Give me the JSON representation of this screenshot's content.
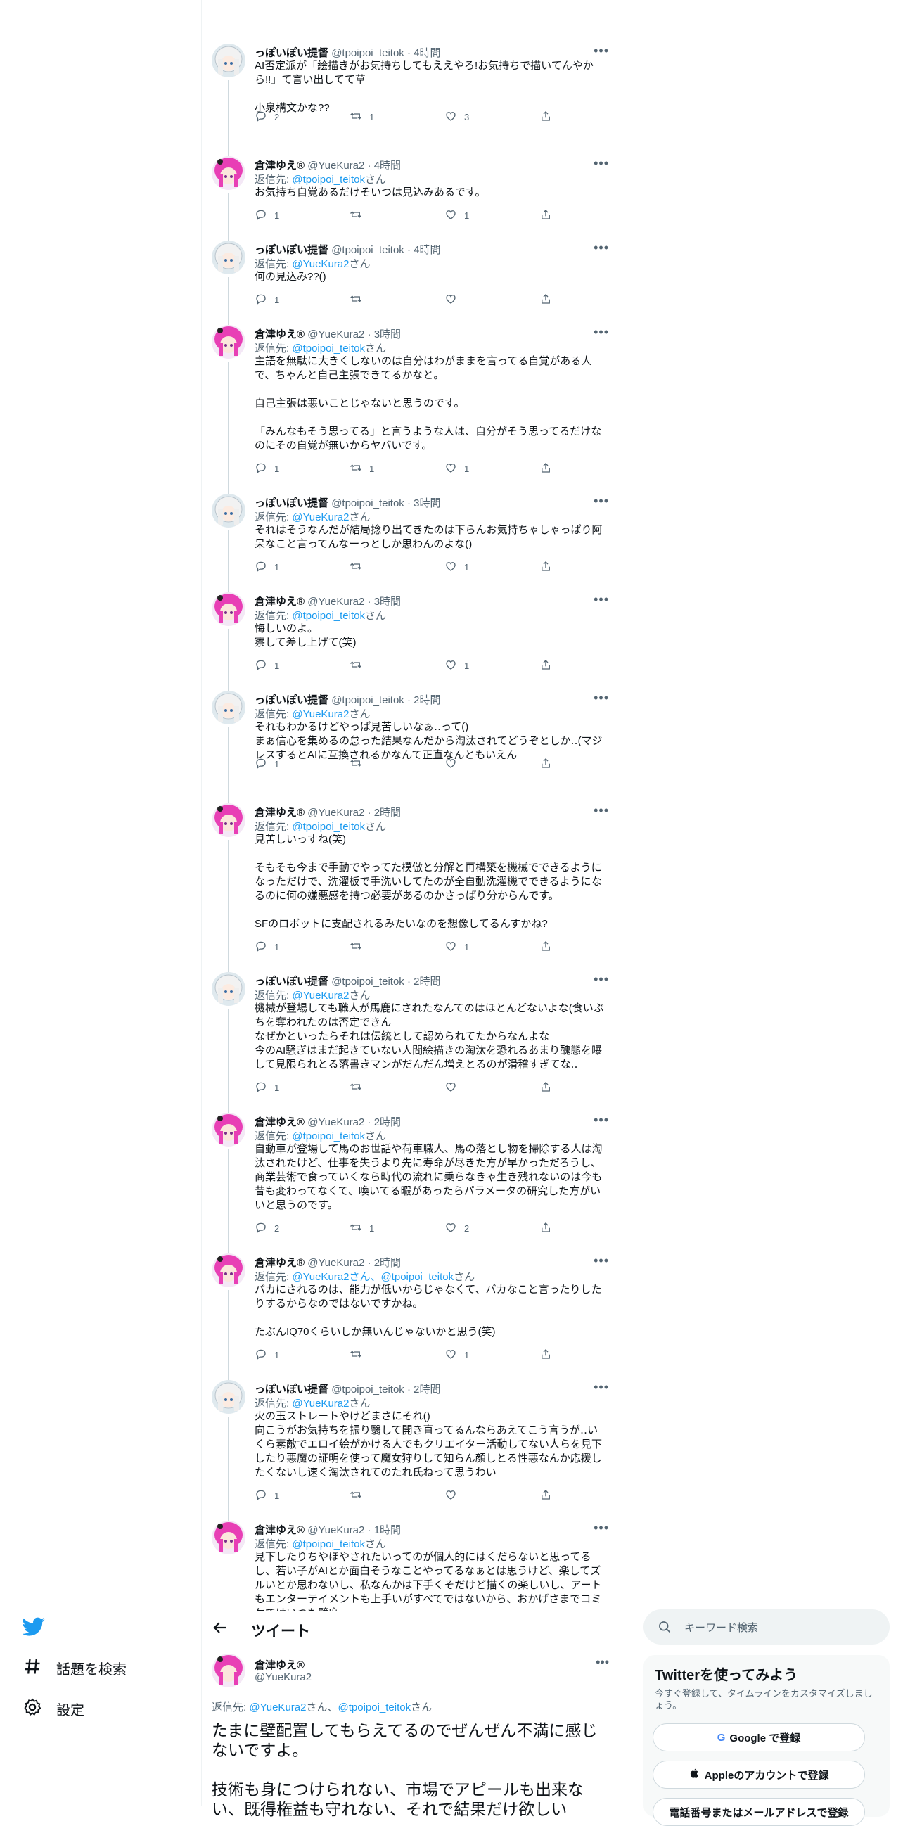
{
  "nav": {
    "explore_label": "話題を検索",
    "settings_label": "設定"
  },
  "header": {
    "title": "ツイート"
  },
  "search": {
    "placeholder": "キーワード検索"
  },
  "promo": {
    "title": "Twitterを使ってみよう",
    "subtitle": "今すぐ登録して、タイムラインをカスタマイズしましょう。",
    "google_label": "Google で登録",
    "apple_label": "Appleのアカウントで登録",
    "phone_label": "電話番号またはメールアドレスで登録"
  },
  "colors": {
    "accent": "#1d9bf0",
    "text": "#0f1419",
    "muted": "#536471",
    "border": "#eff3f4"
  },
  "thread": [
    {
      "user": "A",
      "name": "っぽいぽい提督",
      "handle": "@tpoipoi_teitok",
      "time": "· 4時間",
      "reply_prefix": "",
      "reply_to": "",
      "reply_suffix": "",
      "text": "AI否定派が「絵描きがお気持ちしてもええやろ!お気持ちで描いてんやから!!」て言い出してて草\n\n小泉構文かな??",
      "replies": "2",
      "retweets": "1",
      "likes": "3"
    },
    {
      "user": "B",
      "name": "倉津ゆえ®",
      "handle": "@YueKura2",
      "time": "· 4時間",
      "reply_prefix": "返信先: ",
      "reply_to": "@tpoipoi_teitok",
      "reply_suffix": "さん",
      "text": "お気持ち自覚あるだけそいつは見込みあるです。",
      "replies": "1",
      "retweets": "",
      "likes": "1"
    },
    {
      "user": "A",
      "name": "っぽいぽい提督",
      "handle": "@tpoipoi_teitok",
      "time": "· 4時間",
      "reply_prefix": "返信先: ",
      "reply_to": "@YueKura2",
      "reply_suffix": "さん",
      "text": "何の見込み??()",
      "replies": "1",
      "retweets": "",
      "likes": ""
    },
    {
      "user": "B",
      "name": "倉津ゆえ®",
      "handle": "@YueKura2",
      "time": "· 3時間",
      "reply_prefix": "返信先: ",
      "reply_to": "@tpoipoi_teitok",
      "reply_suffix": "さん",
      "text": "主語を無駄に大きくしないのは自分はわがままを言ってる自覚がある人で、ちゃんと自己主張できてるかなと。\n\n自己主張は悪いことじゃないと思うのです。\n\n「みんなもそう思ってる」と言うような人は、自分がそう思ってるだけなのにその自覚が無いからヤバいです。",
      "replies": "1",
      "retweets": "1",
      "likes": "1"
    },
    {
      "user": "A",
      "name": "っぽいぽい提督",
      "handle": "@tpoipoi_teitok",
      "time": "· 3時間",
      "reply_prefix": "返信先: ",
      "reply_to": "@YueKura2",
      "reply_suffix": "さん",
      "text": "それはそうなんだが結局捻り出てきたのは下らんお気持ちゃしゃっぱり阿呆なこと言ってんなーっとしか思わんのよな()",
      "replies": "1",
      "retweets": "",
      "likes": "1"
    },
    {
      "user": "B",
      "name": "倉津ゆえ®",
      "handle": "@YueKura2",
      "time": "· 3時間",
      "reply_prefix": "返信先: ",
      "reply_to": "@tpoipoi_teitok",
      "reply_suffix": "さん",
      "text": "悔しいのよ。\n察して差し上げて(笑)",
      "replies": "1",
      "retweets": "",
      "likes": "1"
    },
    {
      "user": "A",
      "name": "っぽいぽい提督",
      "handle": "@tpoipoi_teitok",
      "time": "· 2時間",
      "reply_prefix": "返信先: ",
      "reply_to": "@YueKura2",
      "reply_suffix": "さん",
      "text": "それもわかるけどやっぱ見苦しいなぁ‥って()\nまぁ信心を集めるの怠った結果なんだから淘汰されてどうぞとしか‥(マジレスするとAIに互換されるかなんて正直なんともいえん",
      "replies": "1",
      "retweets": "",
      "likes": ""
    },
    {
      "user": "B",
      "name": "倉津ゆえ®",
      "handle": "@YueKura2",
      "time": "· 2時間",
      "reply_prefix": "返信先: ",
      "reply_to": "@tpoipoi_teitok",
      "reply_suffix": "さん",
      "text": "見苦しいっすね(笑)\n\nそもそも今まで手動でやってた模倣と分解と再構築を機械でできるようになっただけで、洗濯板で手洗いしてたのが全自動洗濯機でできるようになるのに何の嫌悪感を持つ必要があるのかさっぱり分からんです。\n\nSFのロボットに支配されるみたいなのを想像してるんすかね?",
      "replies": "1",
      "retweets": "",
      "likes": "1"
    },
    {
      "user": "A",
      "name": "っぽいぽい提督",
      "handle": "@tpoipoi_teitok",
      "time": "· 2時間",
      "reply_prefix": "返信先: ",
      "reply_to": "@YueKura2",
      "reply_suffix": "さん",
      "text": "機械が登場しても職人が馬鹿にされたなんてのはほとんどないよな(食いぶちを奪われたのは否定できん\nなぜかといったらそれは伝統として認められてたからなんよな\n今のAI騒ぎはまだ起きていない人間絵描きの淘汰を恐れるあまり醜態を曝して見限られとる落書きマンがだんだん増えとるのが滑稽すぎてな‥",
      "replies": "1",
      "retweets": "",
      "likes": ""
    },
    {
      "user": "B",
      "name": "倉津ゆえ®",
      "handle": "@YueKura2",
      "time": "· 2時間",
      "reply_prefix": "返信先: ",
      "reply_to": "@tpoipoi_teitok",
      "reply_suffix": "さん",
      "text": "自動車が登場して馬のお世話や荷車職人、馬の落とし物を掃除する人は淘汰されたけど、仕事を失うより先に寿命が尽きた方が早かっただろうし、商業芸術で食っていくなら時代の流れに乗らなきゃ生き残れないのは今も昔も変わってなくて、喚いてる暇があったらパラメータの研究した方がいいと思うのです。",
      "replies": "2",
      "retweets": "1",
      "likes": "2"
    },
    {
      "user": "B",
      "name": "倉津ゆえ®",
      "handle": "@YueKura2",
      "time": "· 2時間",
      "reply_prefix": "返信先: ",
      "reply_to": "@YueKura2さん、@tpoipoi_teitok",
      "reply_suffix": "さん",
      "text": "バカにされるのは、能力が低いからじゃなくて、バカなこと言ったりしたりするからなのではないですかね。\n\nたぶんIQ70くらいしか無いんじゃないかと思う(笑)",
      "replies": "1",
      "retweets": "",
      "likes": "1"
    },
    {
      "user": "A",
      "name": "っぽいぽい提督",
      "handle": "@tpoipoi_teitok",
      "time": "· 2時間",
      "reply_prefix": "返信先: ",
      "reply_to": "@YueKura2",
      "reply_suffix": "さん",
      "text": "火の玉ストレートやけどまさにそれ()\n向こうがお気持ちを振り翳して開き直ってるんならあえてこう言うが‥いくら素敵でエロイ絵がかける人でもクリエイター活動してない人らを見下したり悪魔の証明を使って魔女狩りして知らん顔しとる性悪なんか応援したくないし速く淘汰されてのたれ氏ねって思うわい",
      "replies": "1",
      "retweets": "",
      "likes": ""
    },
    {
      "user": "B",
      "name": "倉津ゆえ®",
      "handle": "@YueKura2",
      "time": "· 1時間",
      "reply_prefix": "返信先: ",
      "reply_to": "@tpoipoi_teitok",
      "reply_suffix": "さん",
      "text": "見下したりちやほやされたいってのが個人的にはくだらないと思ってるし、若い子がAIとか面白そうなことやってるなぁとは思うけど、楽してズルいとか思わないし、私なんかは下手くそだけど描くの楽しいし、アートもエンターテイメントも上手いがすべてではないから、おかげさまでコミケではいつも壁席",
      "replies": "",
      "retweets": "",
      "likes": ""
    }
  ],
  "focused": {
    "name": "倉津ゆえ®",
    "handle": "@YueKura2",
    "reply_prefix": "返信先: ",
    "reply_to_1": "@YueKura2",
    "reply_mid": "さん、",
    "reply_to_2": "@tpoipoi_teitok",
    "reply_suffix": "さん",
    "text": "たまに壁配置してもらえてるのでぜんぜん不満に感じないですよ。\n\n技術も身につけられない、市場でアピールも出来ない、既得権益も守れない、それで結果だけ欲しい"
  }
}
